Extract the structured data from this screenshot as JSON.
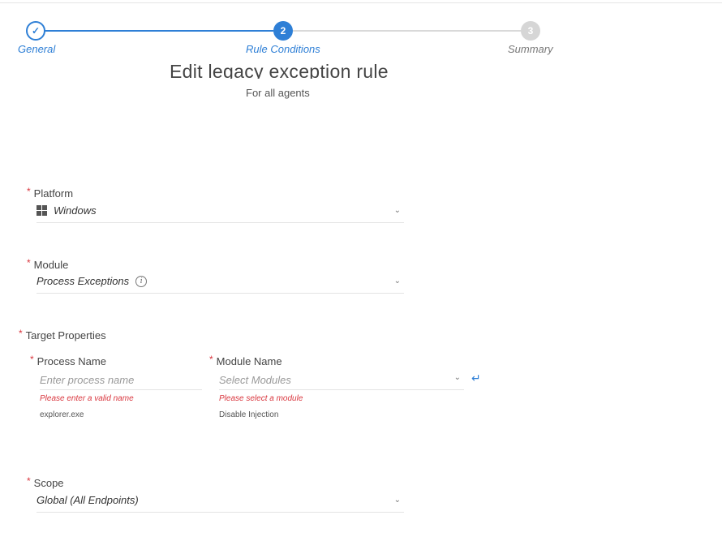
{
  "stepper": {
    "steps": [
      {
        "number": "",
        "label": "General",
        "state": "done"
      },
      {
        "number": "2",
        "label": "Rule Conditions",
        "state": "active"
      },
      {
        "number": "3",
        "label": "Summary",
        "state": "pending"
      }
    ],
    "active_color": "#2e7fd6",
    "pending_color": "#d6d6d6"
  },
  "header": {
    "title": "Edit legacy exception rule",
    "subtitle": "For all agents"
  },
  "form": {
    "required_marker": "*",
    "platform": {
      "label": "Platform",
      "value": "Windows",
      "icon": "windows-icon"
    },
    "module": {
      "label": "Module",
      "value": "Process Exceptions",
      "icon": "info-icon"
    },
    "target_properties": {
      "label": "Target Properties",
      "process_name": {
        "label": "Process Name",
        "placeholder": "Enter process name",
        "error": "Please enter a valid name",
        "hint": "explorer.exe"
      },
      "module_name": {
        "label": "Module Name",
        "placeholder": "Select Modules",
        "error": "Please select a module",
        "hint": "Disable Injection",
        "enter_icon": "enter-icon"
      }
    },
    "scope": {
      "label": "Scope",
      "value": "Global (All Endpoints)"
    }
  },
  "colors": {
    "accent": "#2e7fd6",
    "error": "#d9363e"
  }
}
